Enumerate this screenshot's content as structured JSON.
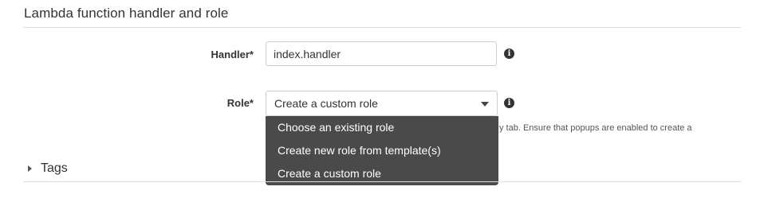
{
  "section": {
    "title": "Lambda function handler and role"
  },
  "handler": {
    "label": "Handler*",
    "value": "index.handler",
    "info_icon": "info-icon"
  },
  "role": {
    "label": "Role*",
    "selected": "Create a custom role",
    "info_icon": "info-icon",
    "helper_text": "y tab. Ensure that popups are enabled to create a",
    "options": [
      "Choose an existing role",
      "Create new role from template(s)",
      "Create a custom role"
    ]
  },
  "tags": {
    "label": "Tags",
    "expand_icon": "caret-right-icon"
  }
}
